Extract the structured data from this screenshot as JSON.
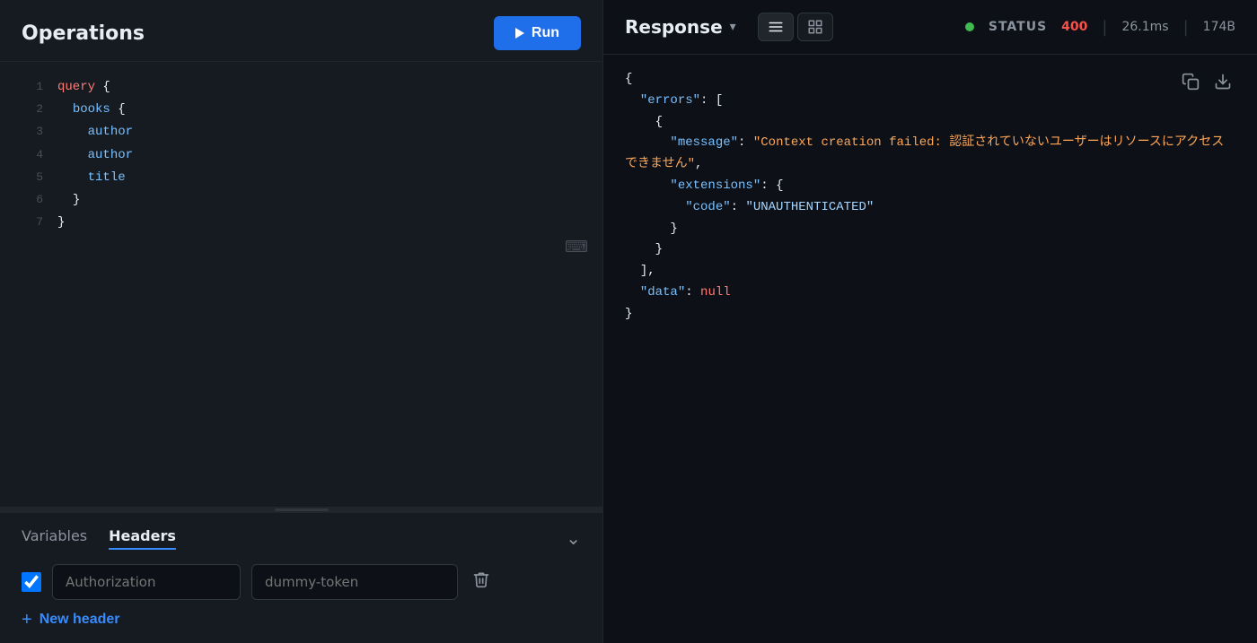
{
  "left": {
    "operations_title": "Operations",
    "run_button_label": "Run",
    "code_lines": [
      {
        "number": "1",
        "indent": 0,
        "tokens": [
          {
            "type": "kw",
            "text": "query"
          },
          {
            "type": "text",
            "text": " {"
          }
        ]
      },
      {
        "number": "2",
        "indent": 1,
        "tokens": [
          {
            "type": "field",
            "text": "books"
          },
          {
            "type": "text",
            "text": " {"
          }
        ]
      },
      {
        "number": "3",
        "indent": 2,
        "tokens": [
          {
            "type": "field",
            "text": "author"
          }
        ]
      },
      {
        "number": "4",
        "indent": 2,
        "tokens": [
          {
            "type": "field",
            "text": "author"
          }
        ]
      },
      {
        "number": "5",
        "indent": 2,
        "tokens": [
          {
            "type": "field",
            "text": "title"
          }
        ]
      },
      {
        "number": "6",
        "indent": 1,
        "tokens": [
          {
            "type": "text",
            "text": "}"
          }
        ]
      },
      {
        "number": "7",
        "indent": 0,
        "tokens": [
          {
            "type": "text",
            "text": "}"
          }
        ]
      }
    ]
  },
  "bottom": {
    "tabs": [
      {
        "label": "Variables",
        "active": false
      },
      {
        "label": "Headers",
        "active": true
      }
    ],
    "headers": [
      {
        "key": "Authorization",
        "value": "dummy-token",
        "enabled": true
      }
    ],
    "new_header_label": "New header",
    "key_placeholder": "Authorization",
    "value_placeholder": "dummy-token"
  },
  "right": {
    "response_title": "Response",
    "status_label": "STATUS",
    "status_code": "400",
    "response_time": "26.1ms",
    "response_size": "174B",
    "json_content": "{\n  \"errors\": [\n    {\n      \"message\": \"Context creation failed: 認証されていないユーザーはリソースにアクセスできません\",\n      \"extensions\": {\n        \"code\": \"UNAUTHENTICATED\"\n      }\n    }\n  ],\n  \"data\": null\n}"
  },
  "icons": {
    "run": "▶",
    "chevron_down": "⌄",
    "list_view": "≡",
    "grid_view": "⊞",
    "copy": "📋",
    "download": "⬇",
    "delete": "🗑",
    "plus": "+",
    "collapse": "⌄",
    "keyboard": "⌨"
  }
}
